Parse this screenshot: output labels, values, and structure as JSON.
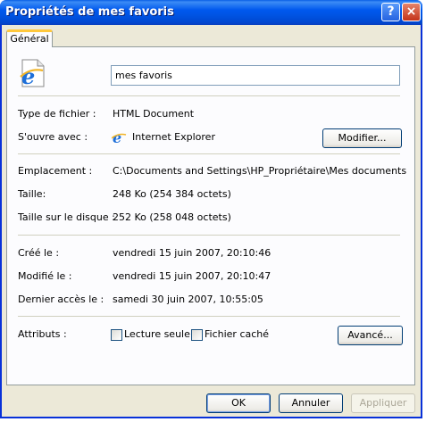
{
  "window": {
    "title": "Propriétés de mes favoris",
    "help_icon": "?",
    "close_icon": "×"
  },
  "tabs": [
    {
      "label": "Général",
      "selected": true
    }
  ],
  "file": {
    "name": "mes favoris",
    "icon": "internet-explorer-html-document-icon",
    "type_label": "Type de fichier :",
    "type_value": "HTML Document",
    "opens_with_label": "S'ouvre avec :",
    "opens_with_value": "Internet Explorer",
    "modify_button": "Modifier..."
  },
  "location": {
    "location_label": "Emplacement :",
    "location_value": "C:\\Documents and Settings\\HP_Propriétaire\\Mes documents",
    "size_label": "Taille:",
    "size_value": "248 Ko (254 384 octets)",
    "disk_size_label": "Taille sur le disque :",
    "disk_size_value": "252 Ko (258 048 octets)"
  },
  "dates": {
    "created_label": "Créé le :",
    "created_value": "vendredi 15 juin 2007, 20:10:46",
    "modified_label": "Modifié le :",
    "modified_value": "vendredi 15 juin 2007, 20:10:47",
    "accessed_label": "Dernier accès le :",
    "accessed_value": "samedi 30 juin 2007, 10:55:05"
  },
  "attributes": {
    "label": "Attributs :",
    "readonly_label": "Lecture seule",
    "readonly_checked": false,
    "hidden_label": "Fichier caché",
    "hidden_checked": false,
    "advanced_button": "Avancé..."
  },
  "footer": {
    "ok": "OK",
    "cancel": "Annuler",
    "apply": "Appliquer",
    "apply_enabled": false
  },
  "colors": {
    "titlebar": "#0054e3",
    "dialog_bg": "#ece9d8",
    "tab_accent": "#ffc83c"
  }
}
